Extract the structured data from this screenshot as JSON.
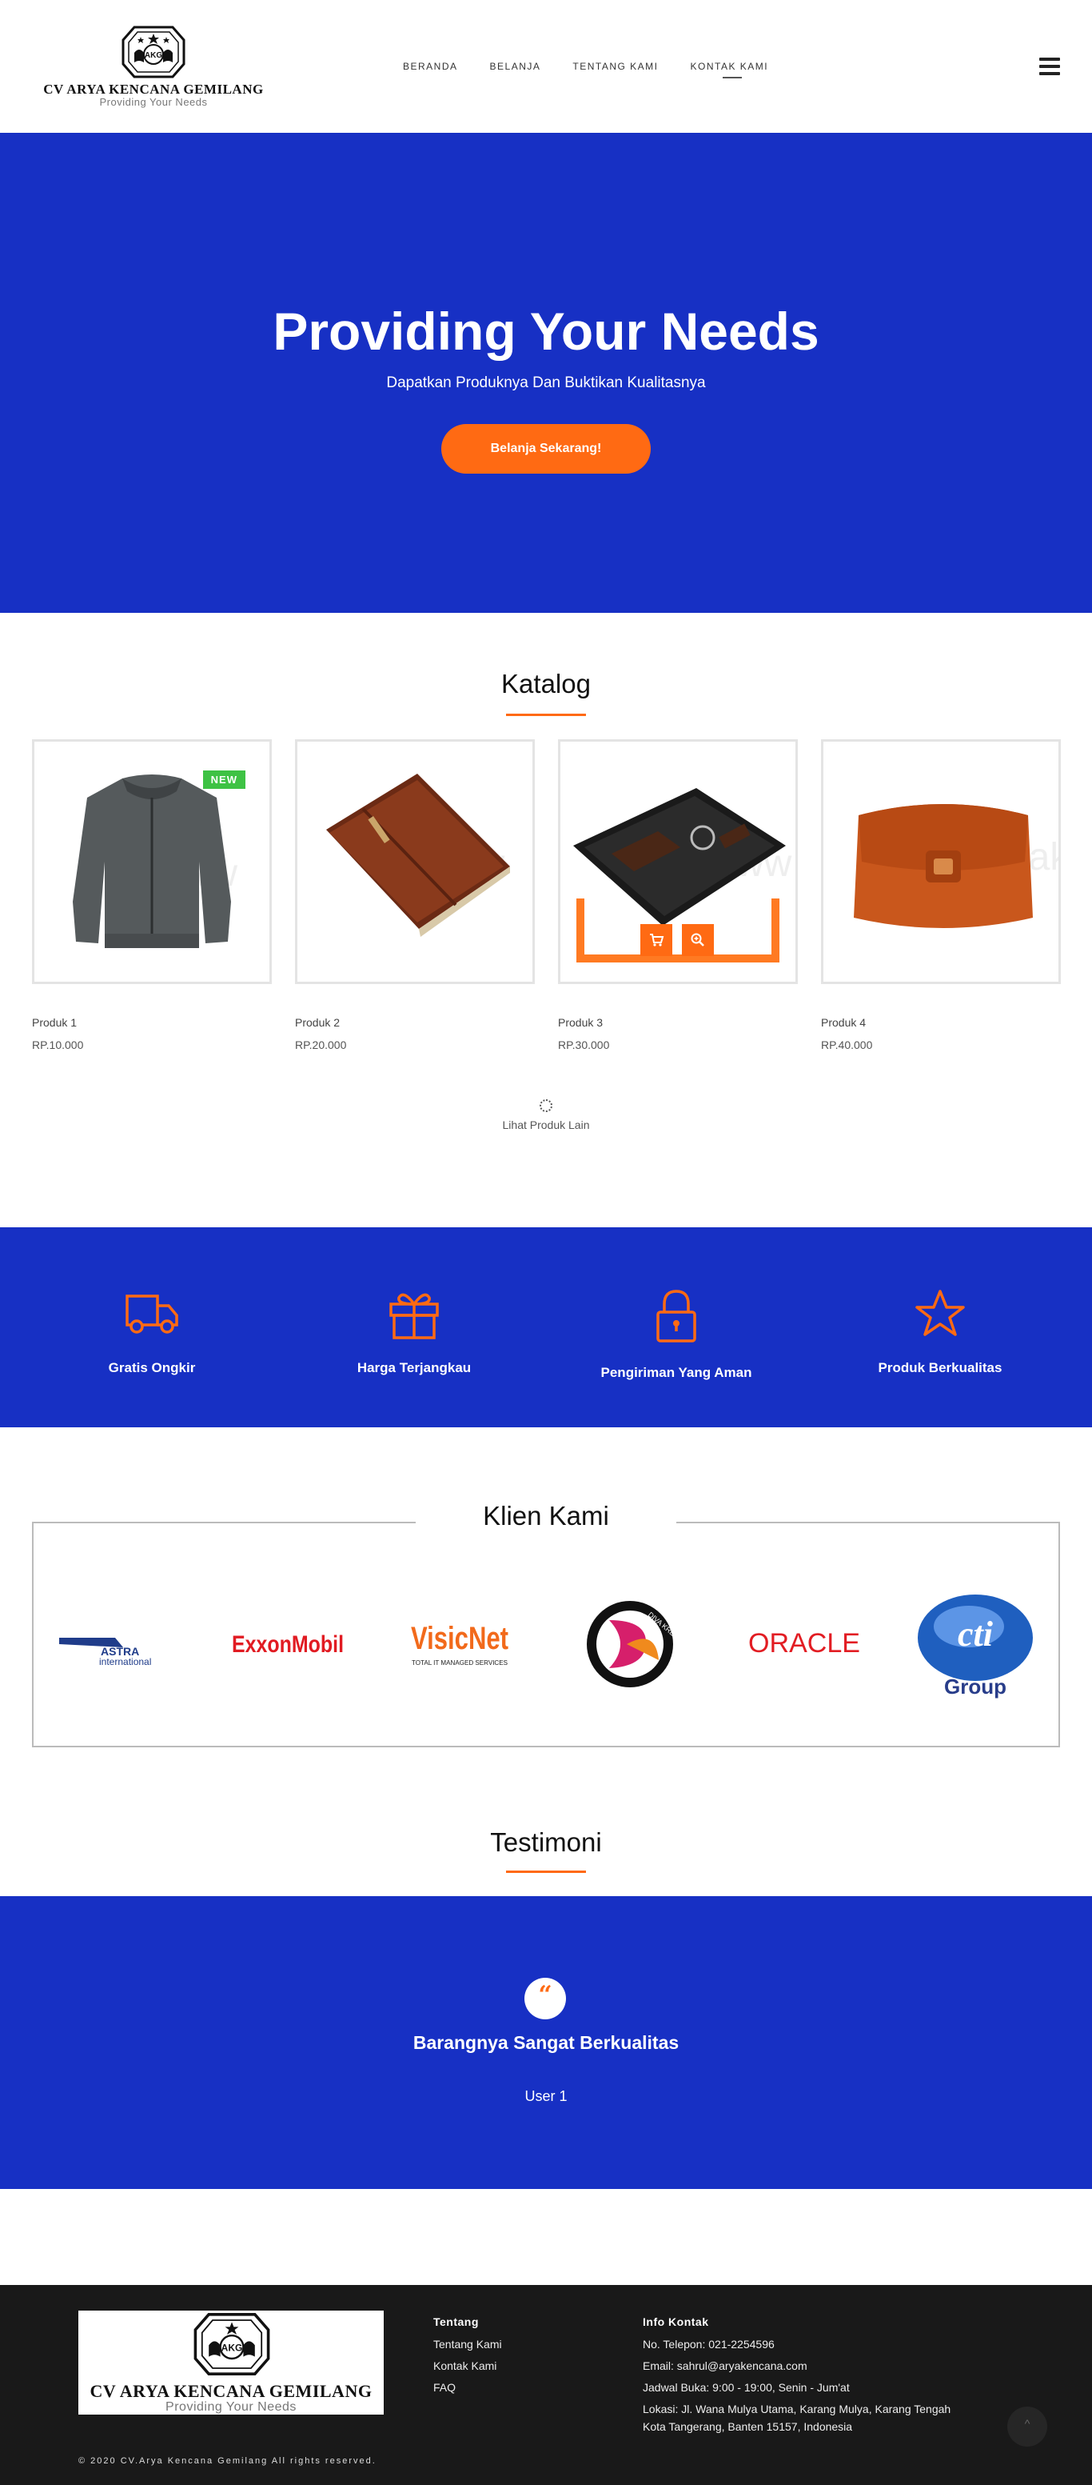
{
  "brand": {
    "name": "CV ARYA KENCANA GEMILANG",
    "tagline": "Providing Your Needs",
    "emblem_text": "AKG"
  },
  "nav": {
    "items": [
      {
        "label": "BERANDA"
      },
      {
        "label": "BELANJA"
      },
      {
        "label": "TENTANG KAMI"
      },
      {
        "label": "KONTAK KAMI"
      }
    ],
    "active_index": 3
  },
  "hero": {
    "title": "Providing Your Needs",
    "subtitle": "Dapatkan Produknya Dan Buktikan Kualitasnya",
    "cta_label": "Belanja Sekarang!",
    "background_color": "#1730c4",
    "cta_color": "#ff6a13"
  },
  "catalog": {
    "title": "Katalog",
    "products": [
      {
        "name": "Produk 1",
        "price": "RP.10.000",
        "badge": "NEW",
        "image": "jacket-image"
      },
      {
        "name": "Produk 2",
        "price": "RP.20.000",
        "badge": "",
        "image": "leather-folder-image"
      },
      {
        "name": "Produk 3",
        "price": "RP.30.000",
        "badge": "",
        "image": "gift-set-image"
      },
      {
        "name": "Produk 4",
        "price": "RP.40.000",
        "badge": "",
        "image": "leather-bag-image"
      }
    ],
    "more_label": "Lihat Produk Lain"
  },
  "features": [
    {
      "label": "Gratis Ongkir",
      "icon": "truck-icon"
    },
    {
      "label": "Harga Terjangkau",
      "icon": "gift-icon"
    },
    {
      "label": "Pengiriman Yang Aman",
      "icon": "lock-icon"
    },
    {
      "label": "Produk Berkualitas",
      "icon": "star-icon"
    }
  ],
  "clients": {
    "title": "Klien Kami",
    "logos": [
      {
        "name": "ASTRA",
        "sub": "international"
      },
      {
        "name": "ExxonMobil"
      },
      {
        "name": "VisicNet",
        "sub": "TOTAL IT MANAGED SERVICES"
      },
      {
        "name": "DIVA KREASINDO"
      },
      {
        "name": "ORACLE"
      },
      {
        "name": "cti",
        "sub": "Group"
      }
    ]
  },
  "testimonials": {
    "title": "Testimoni",
    "quote_mark": "“",
    "text": "Barangnya Sangat Berkualitas",
    "author": "User 1"
  },
  "footer": {
    "about": {
      "heading": "Tentang",
      "links": [
        "Tentang Kami",
        "Kontak Kami",
        "FAQ"
      ]
    },
    "contact": {
      "heading": "Info Kontak",
      "lines": [
        "No. Telepon: 021-2254596",
        "Email: sahrul@aryakencana.com",
        "Jadwal Buka: 9:00 - 19:00, Senin - Jum'at",
        "Lokasi: Jl. Wana Mulya Utama, Karang Mulya, Karang Tengah",
        "Kota Tangerang, Banten 15157, Indonesia"
      ]
    },
    "copyright": "© 2020 CV.Arya Kencana Gemilang All rights reserved.",
    "to_top": "^"
  }
}
